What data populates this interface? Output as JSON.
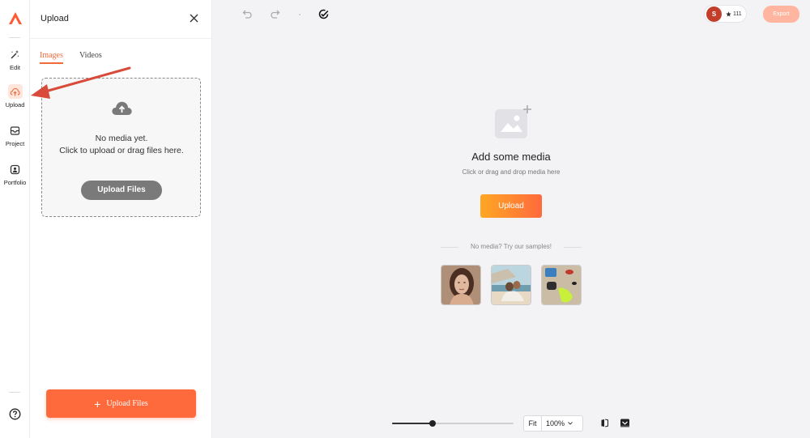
{
  "colors": {
    "accent": "#ff6a3d",
    "accent_light": "#ffe6dc",
    "export_disabled": "#ffb5a0"
  },
  "rail": {
    "items": [
      {
        "label": "Edit",
        "icon": "magic-wand-icon"
      },
      {
        "label": "Upload",
        "icon": "upload-cloud-icon",
        "active": true
      },
      {
        "label": "Project",
        "icon": "project-icon"
      },
      {
        "label": "Portfolio",
        "icon": "portfolio-icon"
      }
    ],
    "help_icon": "help-icon"
  },
  "panel": {
    "title": "Upload",
    "tabs": [
      {
        "label": "Images",
        "active": true
      },
      {
        "label": "Videos"
      }
    ],
    "dropzone": {
      "line1": "No media yet.",
      "line2": "Click to upload or drag files here.",
      "button": "Upload Files"
    },
    "upload_button": "Upload Files"
  },
  "topbar": {
    "user_initial": "S",
    "credits": "111",
    "export_label": "Export"
  },
  "canvas": {
    "title": "Add some media",
    "subtitle": "Click or drag and drop media here",
    "upload_label": "Upload",
    "samples_label": "No media? Try our samples!",
    "samples": [
      "portrait-sample",
      "beach-sample",
      "fashion-sample"
    ]
  },
  "zoom": {
    "fit_label": "Fit",
    "value": "100%",
    "slider_fraction": 0.33
  }
}
